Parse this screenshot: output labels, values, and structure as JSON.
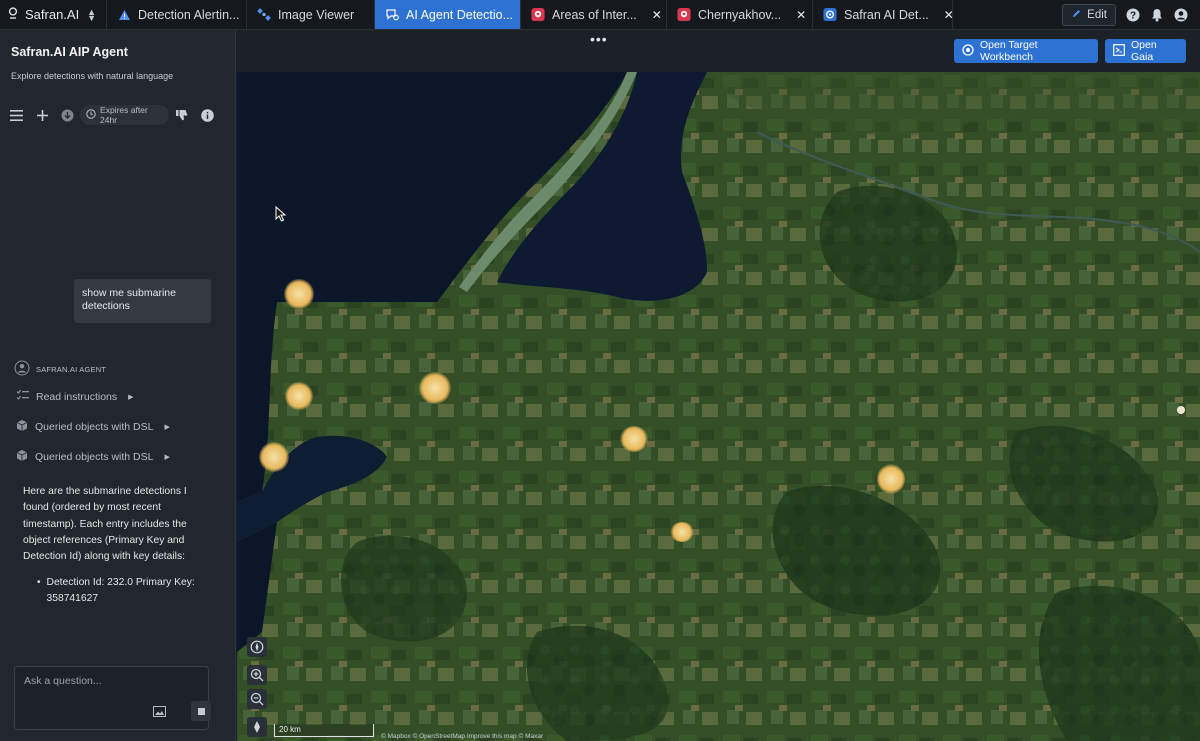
{
  "app": {
    "brand": "Safran.AI"
  },
  "tabs": [
    {
      "label": "Detection Alertin...",
      "icon": "warning-triangle-icon",
      "active": false,
      "closable": false
    },
    {
      "label": "Image Viewer",
      "icon": "satellite-icon",
      "active": false,
      "closable": false
    },
    {
      "label": "AI Agent Detectio...",
      "icon": "chat-agent-icon",
      "active": true,
      "closable": false
    },
    {
      "label": "Areas of Inter...",
      "icon": "map-pin-app-icon",
      "active": false,
      "closable": true
    },
    {
      "label": "Chernyakhov...",
      "icon": "map-pin-app-icon",
      "active": false,
      "closable": true
    },
    {
      "label": "Safran AI Det...",
      "icon": "safran-app-icon",
      "active": false,
      "closable": true
    }
  ],
  "topbar_right": {
    "edit_label": "Edit"
  },
  "panel": {
    "title": "Safran.AI AIP Agent",
    "subtitle": "Explore detections with natural language",
    "expires_label": "Expires after 24hr"
  },
  "conversation": {
    "user_message": "show me submarine detections",
    "agent_label": "SAFRAN.AI AGENT",
    "steps": [
      "Read instructions",
      "Queried objects with DSL",
      "Queried objects with DSL"
    ],
    "answer": "Here are the submarine detections I found (ordered by most recent timestamp). Each entry includes the object references (Primary Key and Detection Id) along with key details:",
    "bullets": [
      "Detection Id: 232.0 Primary Key: 358741627"
    ]
  },
  "composer": {
    "placeholder": "Ask a question..."
  },
  "map_header": {
    "ellipsis": "•••",
    "open_target_label": "Open Target Workbench",
    "open_gaia_label": "Open Gaia"
  },
  "map": {
    "scale_label": "20 km",
    "attribution": "© Mapbox © OpenStreetMap Improve this map © Maxar",
    "detection_color": "#f0c46a"
  },
  "colors": {
    "accent": "#2d72d2",
    "water": "#0c1629",
    "land": "#2f4a25",
    "panel_bg": "#22272e"
  }
}
